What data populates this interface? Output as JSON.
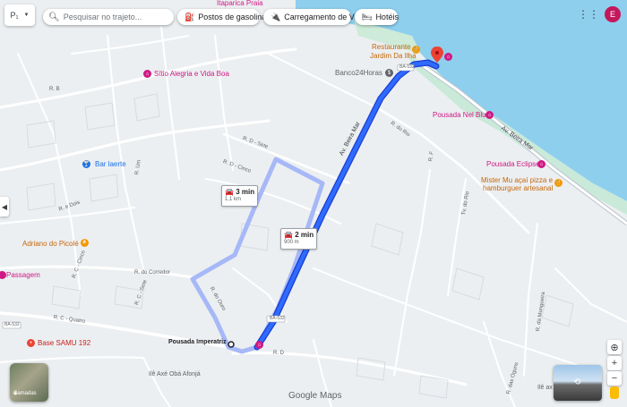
{
  "search": {
    "placeholder": "Pesquisar no trajeto..."
  },
  "mode_button": {
    "label": "P₁"
  },
  "chips": [
    {
      "label": "Postos de gasolina",
      "icon": "gas-station-icon"
    },
    {
      "label": "Carregamento de VE",
      "icon": "ev-charger-icon"
    },
    {
      "label": "Hotéis",
      "icon": "bed-icon"
    }
  ],
  "account": {
    "initial": "E",
    "color": "#c2185b"
  },
  "route_primary": {
    "time": "2 min",
    "distance": "900 m",
    "color": "#1a53ff"
  },
  "route_alt": {
    "time": "3 min",
    "distance": "1,1 km",
    "color": "#a6b8f7"
  },
  "places": {
    "itaparica": "Itaparica Praia",
    "restaurante_l1": "Restaurante",
    "restaurante_l2": "Jardim Da Ilha",
    "banco": "Banco24Horas",
    "sitio": "Sítio Alegria e Vida Boa",
    "pousada_nel": "Pousada Nel Blu",
    "bar": "Bar laerte",
    "pousada_eclipse": "Pousada Eclipse",
    "mister_l1": "Mister Mu açaí pizza e",
    "mister_l2": "hamburguer artesanal",
    "adriano": "Adriano do Picolé",
    "passagem": "Passagem",
    "samu": "Base SAMU 192",
    "pousada_imp": "Pousada Imperatriz",
    "ile": "Ilê Axé Obá Afonjá",
    "ile_right": "Ilê ax"
  },
  "roads": {
    "av_beira_mar": "Av. Beira Mar",
    "r_do_rio": "R. do Rio",
    "r_d_sete": "R. D - Sete",
    "r_d_cinco": "R. D - Cinco",
    "r_do_corredor": "R. do Corredor",
    "r_c_quatro": "R. C - Quatro",
    "r_c_cinco": "R. C - Cinco",
    "r_c_sete": "R. C - Sete",
    "r_e_dois": "R. e Dois",
    "r_b": "R. B",
    "r_f": "R. F",
    "r_d": "R. D",
    "r_do_ouro": "R. do Ouro",
    "r_da_mungueira": "R. da Mungueira",
    "r_das_oguns": "R. das Oguns",
    "r_um": "R. Um",
    "av_beira_mar_2": "Av. Beira Mar",
    "tv_do_rio": "Tv. do Rio",
    "ba_532": "BA-532"
  },
  "brand": "Google Maps",
  "layers_label": "Camadas"
}
